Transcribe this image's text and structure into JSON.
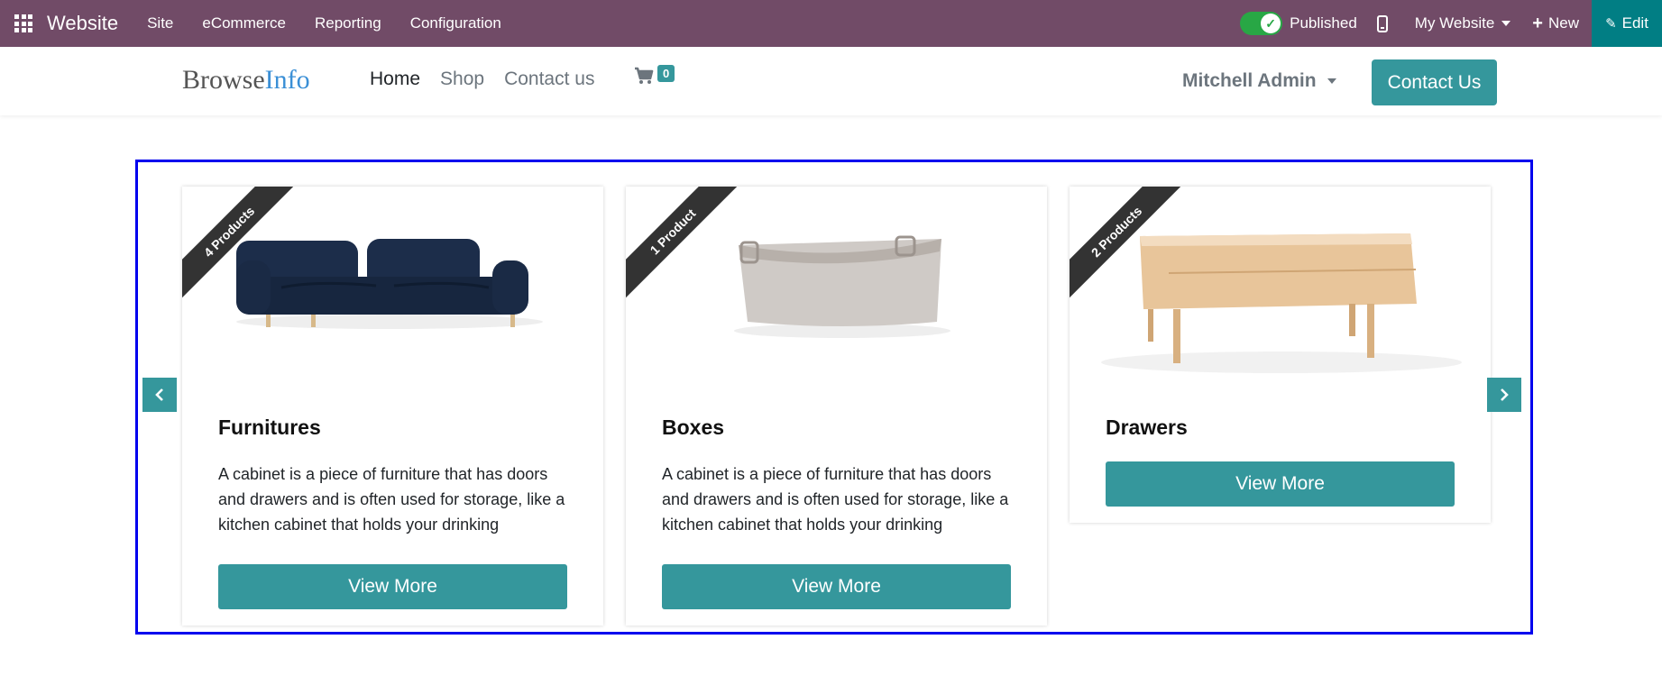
{
  "admin_bar": {
    "app_title": "Website",
    "menu": [
      "Site",
      "eCommerce",
      "Reporting",
      "Configuration"
    ],
    "published_label": "Published",
    "my_website_label": "My Website",
    "new_label": "New",
    "edit_label": "Edit"
  },
  "header": {
    "logo_part1": "Browse",
    "logo_part2": "Info",
    "nav": [
      "Home",
      "Shop",
      "Contact us"
    ],
    "cart_count": "0",
    "user_name": "Mitchell Admin",
    "contact_button": "Contact Us"
  },
  "categories": [
    {
      "ribbon": "4 Products",
      "title": "Furnitures",
      "description": "A cabinet is a piece of furniture that has doors and drawers and is often used for storage, like a kitchen cabinet that holds your drinking",
      "button": "View More"
    },
    {
      "ribbon": "1 Product",
      "title": "Boxes",
      "description": "A cabinet is a piece of furniture that has doors and drawers and is often used for storage, like a kitchen cabinet that holds your drinking",
      "button": "View More"
    },
    {
      "ribbon": "2 Products",
      "title": "Drawers",
      "description": "",
      "button": "View More"
    }
  ],
  "colors": {
    "admin_bar": "#714b67",
    "accent": "#35979c",
    "edit_bg": "#017e84",
    "selection_border": "#0000ee"
  }
}
